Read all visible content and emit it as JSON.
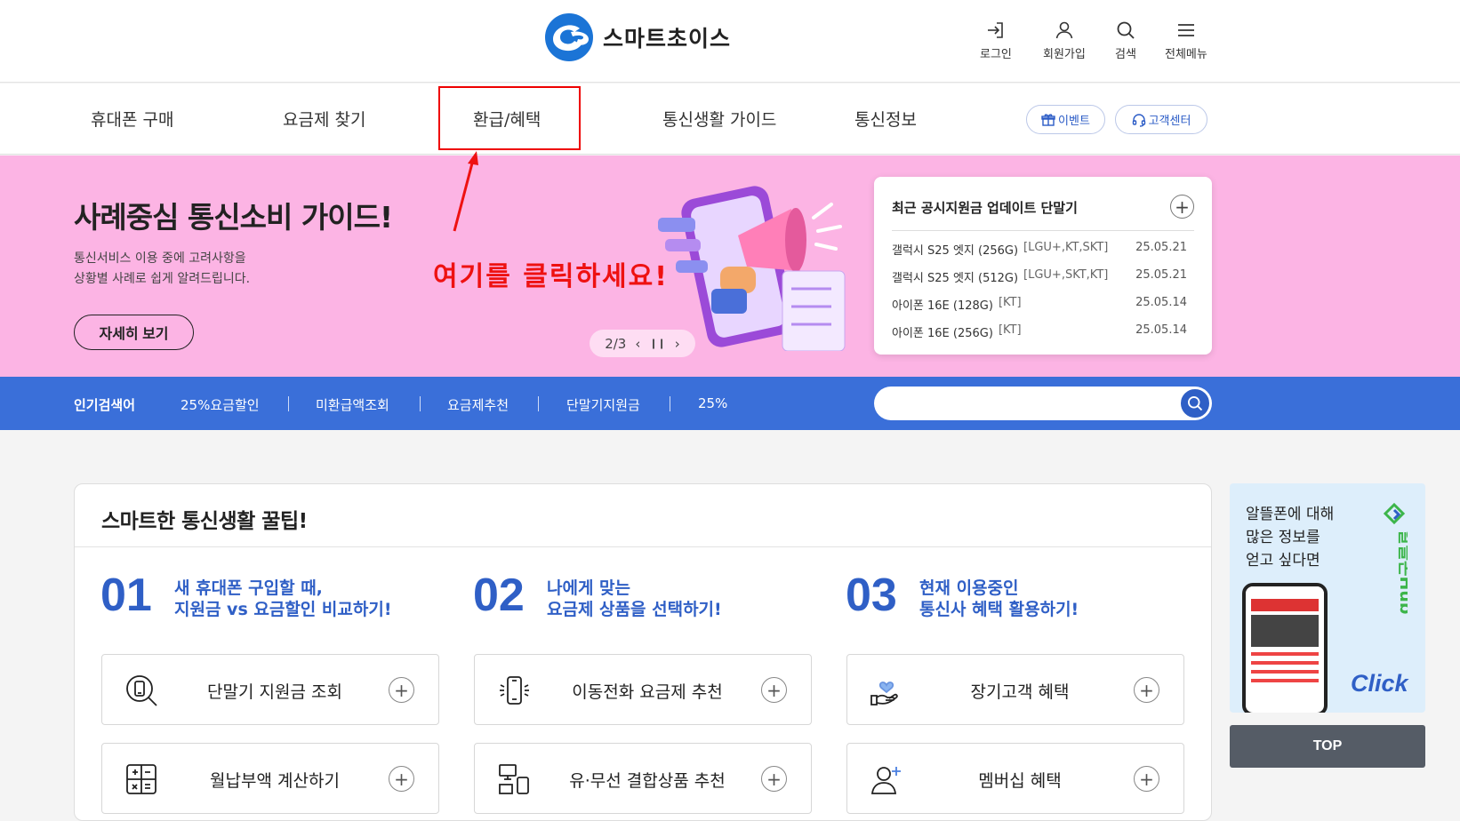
{
  "header": {
    "logo_text": "스마트초이스",
    "utils": [
      {
        "label": "로그인",
        "icon": "login-icon"
      },
      {
        "label": "회원가입",
        "icon": "user-icon"
      },
      {
        "label": "검색",
        "icon": "search-icon"
      },
      {
        "label": "전체메뉴",
        "icon": "menu-icon"
      }
    ]
  },
  "nav": {
    "items": [
      "휴대폰 구매",
      "요금제 찾기",
      "환급/혜택",
      "통신생활 가이드",
      "통신정보"
    ],
    "event_label": "이벤트",
    "support_label": "고객센터",
    "highlight_color": "#ee0000"
  },
  "annotation": {
    "text": "여기를 클릭하세요!",
    "color": "#ee1111"
  },
  "banner": {
    "title": "사례중심 통신소비 가이드!",
    "sub1": "통신서비스 이용 중에 고려사항을",
    "sub2": "상황별 사례로 쉽게 알려드립니다.",
    "more_label": "자세히 보기",
    "bg_color": "#fcb4e4",
    "slide_index": "2/3"
  },
  "update": {
    "title": "최근 공시지원금 업데이트 단말기",
    "rows": [
      {
        "name": "갤럭시 S25 엣지 (256G)",
        "carrier": "[LGU+,KT,SKT]",
        "date": "25.05.21"
      },
      {
        "name": "갤럭시 S25 엣지 (512G)",
        "carrier": "[LGU+,SKT,KT]",
        "date": "25.05.21"
      },
      {
        "name": "아이폰 16E (128G)",
        "carrier": "[KT]",
        "date": "25.05.14"
      },
      {
        "name": "아이폰 16E (256G)",
        "carrier": "[KT]",
        "date": "25.05.14"
      }
    ]
  },
  "keywords": {
    "label": "인기검색어",
    "items": [
      "25%요금할인",
      "미환급액조회",
      "요금제추천",
      "단말기지원금",
      "25%"
    ],
    "search_value": "",
    "bar_color": "#3a6fd9"
  },
  "tips": {
    "title": "스마트한 통신생활 꿀팁!",
    "steps": [
      {
        "num": "01",
        "line1": "새 휴대폰 구입할 때,",
        "line2": "지원금 vs 요금할인 비교하기!"
      },
      {
        "num": "02",
        "line1": "나에게 맞는",
        "line2": "요금제 상품을 선택하기!"
      },
      {
        "num": "03",
        "line1": "현재 이용중인",
        "line2": "통신사 혜택 활용하기!"
      }
    ],
    "cards": [
      {
        "label": "단말기 지원금 조회",
        "icon": "phone-search-icon"
      },
      {
        "label": "이동전화 요금제 추천",
        "icon": "mobile-phone-icon"
      },
      {
        "label": "장기고객 혜택",
        "icon": "heart-hand-icon"
      },
      {
        "label": "월납부액 계산하기",
        "icon": "calculator-icon"
      },
      {
        "label": "유·무선 결합상품 추천",
        "icon": "devices-icon"
      },
      {
        "label": "멤버십 혜택",
        "icon": "add-user-icon"
      }
    ],
    "accent_color": "#2f5fc6"
  },
  "side_ad": {
    "line1": "알뜰폰에 대해",
    "line2": "많은 정보를",
    "line3": "얻고 싶다면",
    "brand": "알뜰폰Hub",
    "click_label": "Click"
  },
  "top_label": "TOP"
}
